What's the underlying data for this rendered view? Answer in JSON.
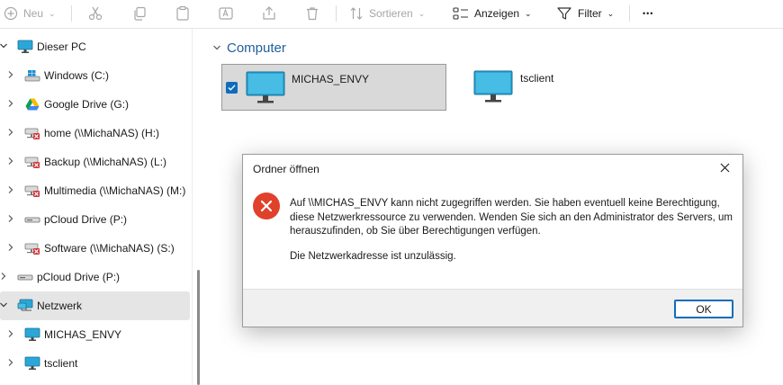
{
  "toolbar": {
    "new_label": "Neu",
    "sort_label": "Sortieren",
    "view_label": "Anzeigen",
    "filter_label": "Filter",
    "more_label": "•••"
  },
  "sidebar": {
    "items": [
      {
        "label": "Dieser PC",
        "icon": "monitor-icon",
        "level": 0,
        "expander": "down"
      },
      {
        "label": "Windows (C:)",
        "icon": "windows-drive-icon",
        "level": 1,
        "expander": "right"
      },
      {
        "label": "Google Drive (G:)",
        "icon": "google-drive-icon",
        "level": 1,
        "expander": "right"
      },
      {
        "label": "home (\\\\MichaNAS) (H:)",
        "icon": "disconnected-network-drive-icon",
        "level": 1,
        "expander": "right"
      },
      {
        "label": "Backup (\\\\MichaNAS) (L:)",
        "icon": "disconnected-network-drive-icon",
        "level": 1,
        "expander": "right"
      },
      {
        "label": "Multimedia (\\\\MichaNAS) (M:)",
        "icon": "disconnected-network-drive-icon",
        "level": 1,
        "expander": "right"
      },
      {
        "label": "pCloud Drive (P:)",
        "icon": "drive-icon",
        "level": 1,
        "expander": "right"
      },
      {
        "label": "Software (\\\\MichaNAS) (S:)",
        "icon": "disconnected-network-drive-icon",
        "level": 1,
        "expander": "right"
      },
      {
        "label": "pCloud Drive (P:)",
        "icon": "drive-icon",
        "level": 0,
        "expander": "right"
      },
      {
        "label": "Netzwerk",
        "icon": "network-icon",
        "level": 0,
        "expander": "down",
        "selected": true
      },
      {
        "label": "MICHAS_ENVY",
        "icon": "monitor-icon",
        "level": 1,
        "expander": "right"
      },
      {
        "label": "tsclient",
        "icon": "monitor-icon",
        "level": 1,
        "expander": "right"
      }
    ]
  },
  "content": {
    "group_title": "Computer",
    "items": [
      {
        "name": "MICHAS_ENVY",
        "selected": true,
        "checked": true
      },
      {
        "name": "tsclient",
        "selected": false
      }
    ]
  },
  "dialog": {
    "title": "Ordner öffnen",
    "message": "Auf \\\\MICHAS_ENVY kann nicht zugegriffen werden. Sie haben eventuell keine Berechtigung, diese Netzwerkressource zu verwenden. Wenden Sie sich an den Administrator des Servers, um herauszufinden, ob Sie über Berechtigungen verfügen.",
    "detail": "Die Netzwerkadresse ist unzulässig.",
    "ok_label": "OK"
  },
  "colors": {
    "accent": "#0f6cbd",
    "error": "#e0412b",
    "group_header": "#1f5f9e",
    "monitor": "#2aa7d8"
  }
}
